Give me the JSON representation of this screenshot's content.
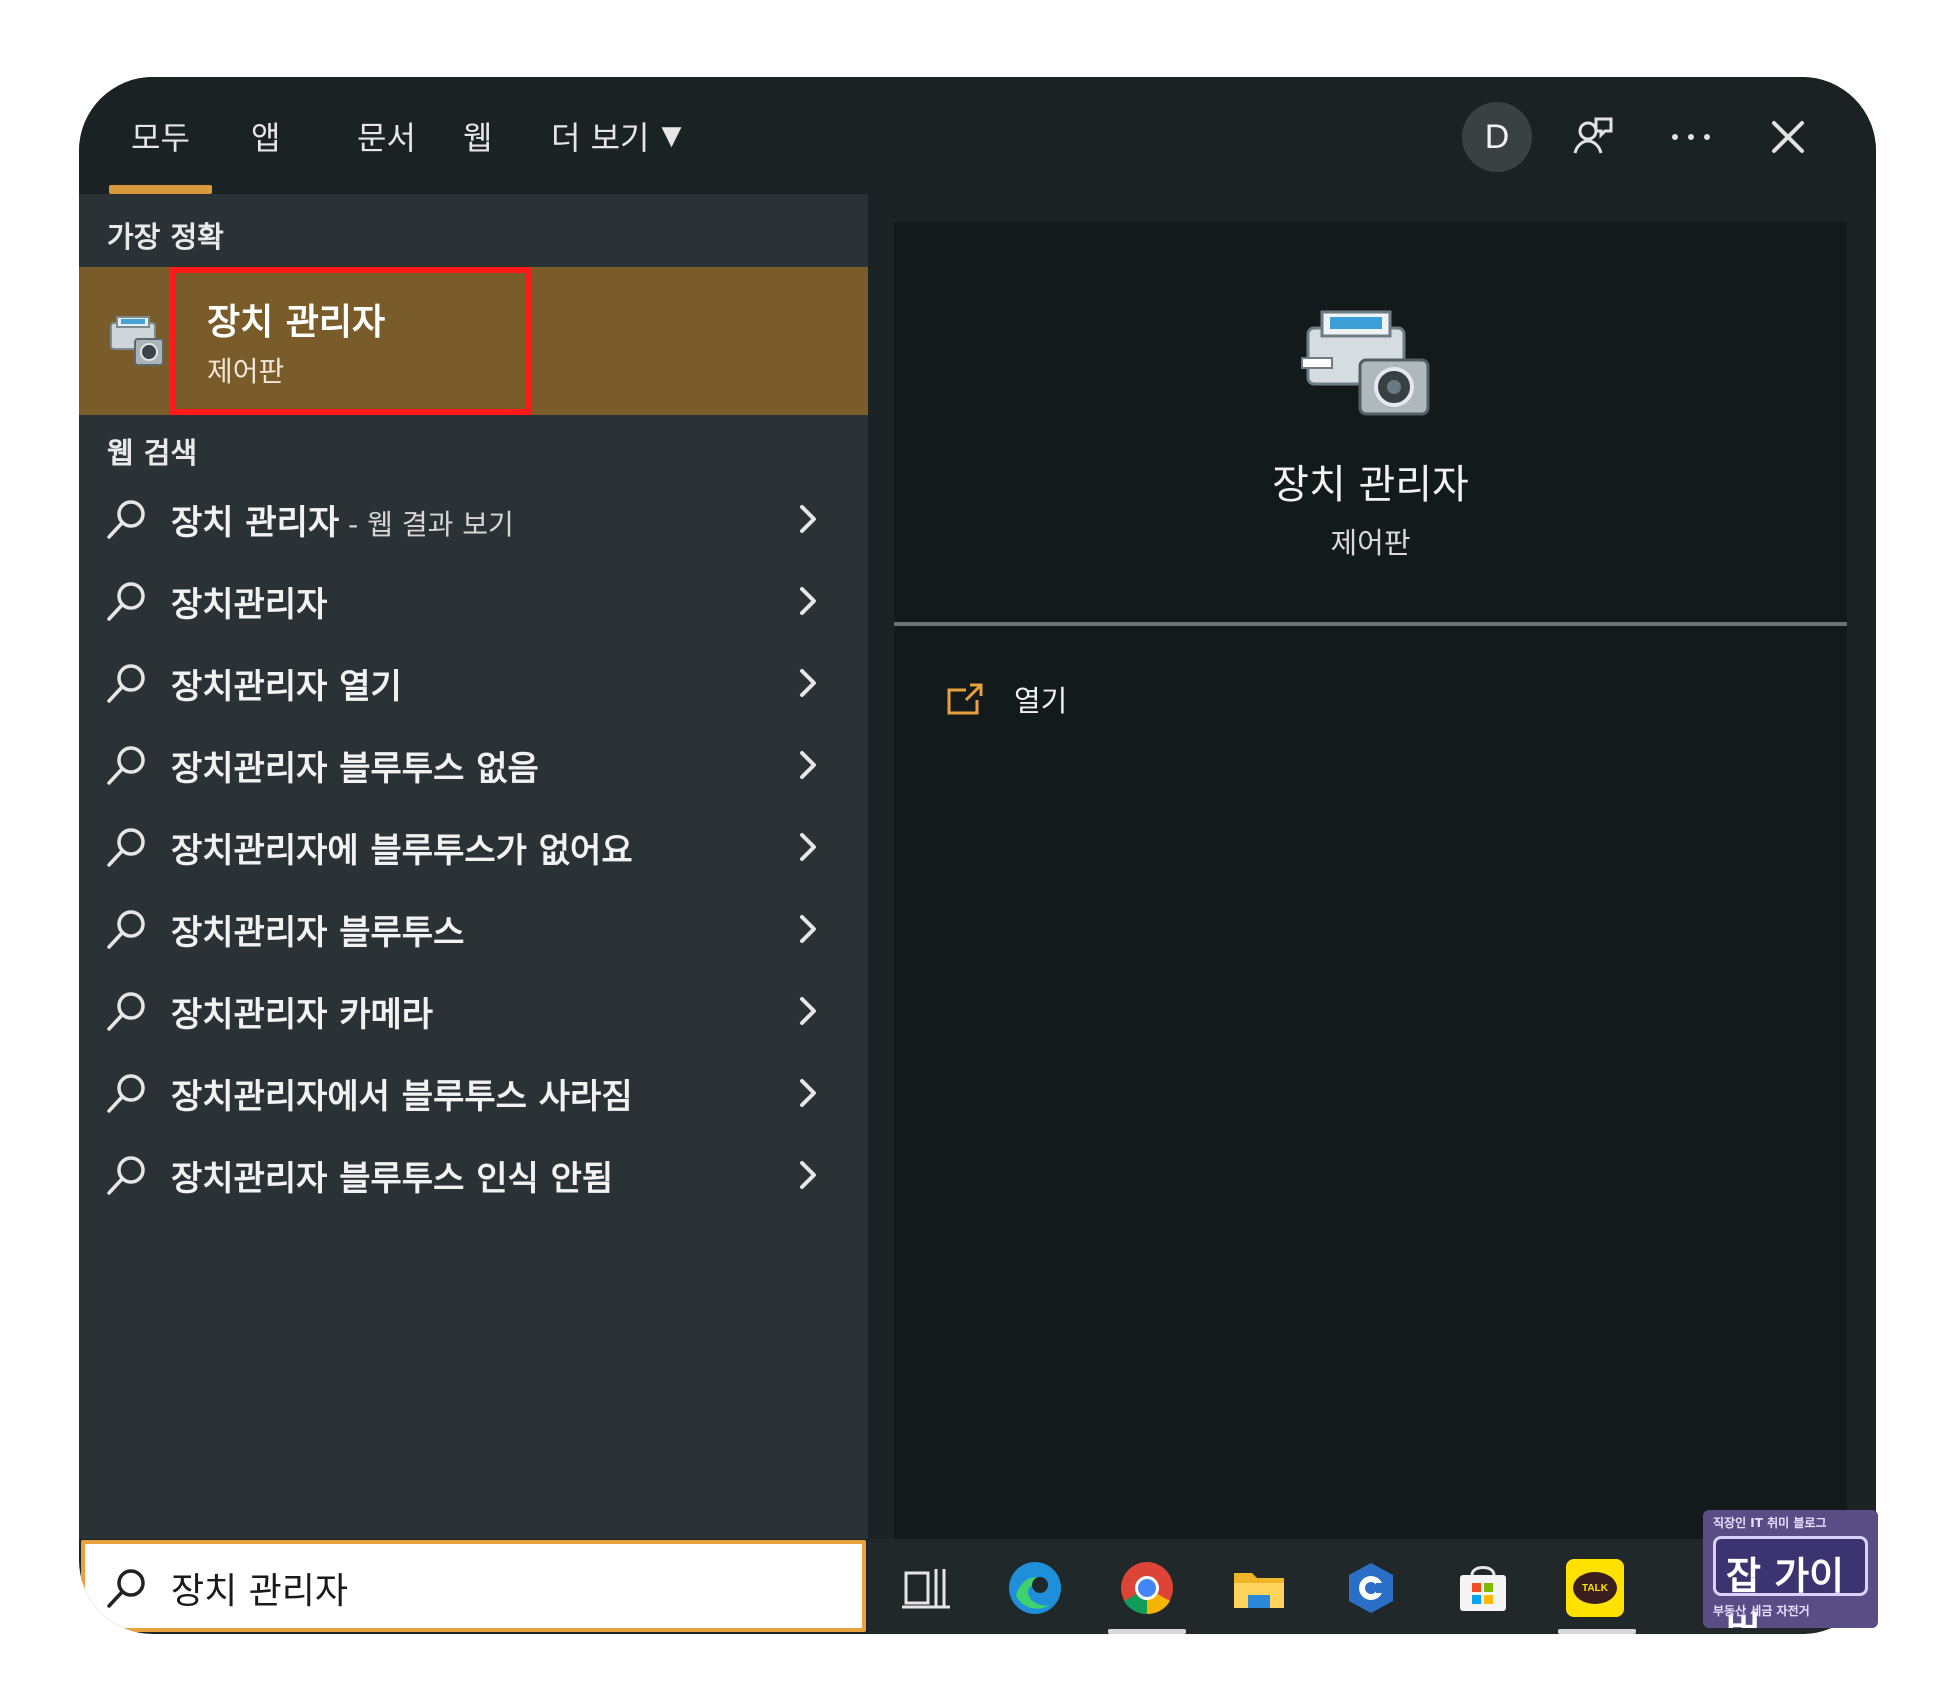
{
  "header": {
    "tabs": [
      {
        "label": "모두",
        "active": true
      },
      {
        "label": "앱",
        "active": false
      },
      {
        "label": "문서",
        "active": false
      },
      {
        "label": "웹",
        "active": false
      },
      {
        "label": "더 보기",
        "active": false
      }
    ],
    "avatar_letter": "D",
    "icons": [
      "feedback-icon",
      "more-options-icon",
      "close-icon"
    ]
  },
  "left_panel": {
    "best_match_header": "가장 정확",
    "best_match": {
      "title": "장치 관리자",
      "subtitle": "제어판",
      "icon": "device-manager-icon"
    },
    "web_search_header": "웹 검색",
    "results": [
      {
        "label": "장치 관리자",
        "suffix": " - 웹 결과 보기"
      },
      {
        "label": "장치관리자",
        "suffix": ""
      },
      {
        "label": "장치관리자 열기",
        "suffix": ""
      },
      {
        "label": "장치관리자 블루투스 없음",
        "suffix": ""
      },
      {
        "label": "장치관리자에 블루투스가 없어요",
        "suffix": ""
      },
      {
        "label": "장치관리자 블루투스",
        "suffix": ""
      },
      {
        "label": "장치관리자 카메라",
        "suffix": ""
      },
      {
        "label": "장치관리자에서 블루투스 사라짐",
        "suffix": ""
      },
      {
        "label": "장치관리자 블루투스 인식 안됨",
        "suffix": ""
      }
    ]
  },
  "right_panel": {
    "title": "장치 관리자",
    "subtitle": "제어판",
    "actions": [
      {
        "label": "열기",
        "icon": "open-icon"
      }
    ]
  },
  "search": {
    "query": "장치 관리자"
  },
  "taskbar": {
    "icons": [
      "task-view-icon",
      "edge-icon",
      "chrome-icon",
      "file-explorer-icon",
      "cc-app-icon",
      "store-icon",
      "kakaotalk-icon"
    ],
    "kakao_label": "TALK"
  },
  "watermark": {
    "top": "직장인 IT 취미 블로그",
    "main": "잡 가이버",
    "bottom": "부동산 세금 자전거"
  },
  "colors": {
    "accent": "#d89a3a",
    "best_match_bg": "#7a5c2b",
    "highlight": "#ff1a1a",
    "left_bg": "#2b3235",
    "right_bg": "#131a1c"
  }
}
